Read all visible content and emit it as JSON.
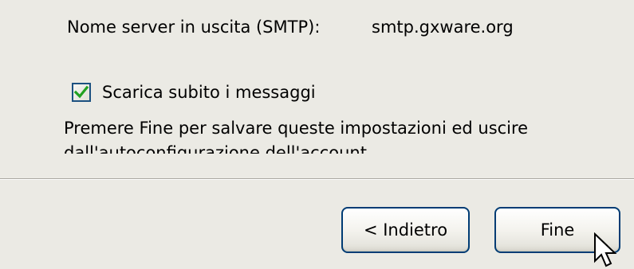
{
  "smtp": {
    "label": "Nome server in uscita (SMTP):",
    "value": "smtp.gxware.org"
  },
  "download_now": {
    "label": "Scarica subito i messaggi",
    "checked": true
  },
  "instructions": {
    "line1": "Premere Fine per salvare queste impostazioni ed uscire",
    "line2_partial": "dall'autoconfigurazione dell'account"
  },
  "buttons": {
    "back_label": "< Indietro",
    "finish_label": "Fine"
  },
  "colors": {
    "dialog_bg": "#ebeae4",
    "button_border": "#003c74",
    "checkbox_border": "#1c5180",
    "checkmark": "#21a121"
  },
  "icons": {
    "checkmark": "checkmark-icon",
    "cursor": "mouse-pointer-icon"
  }
}
